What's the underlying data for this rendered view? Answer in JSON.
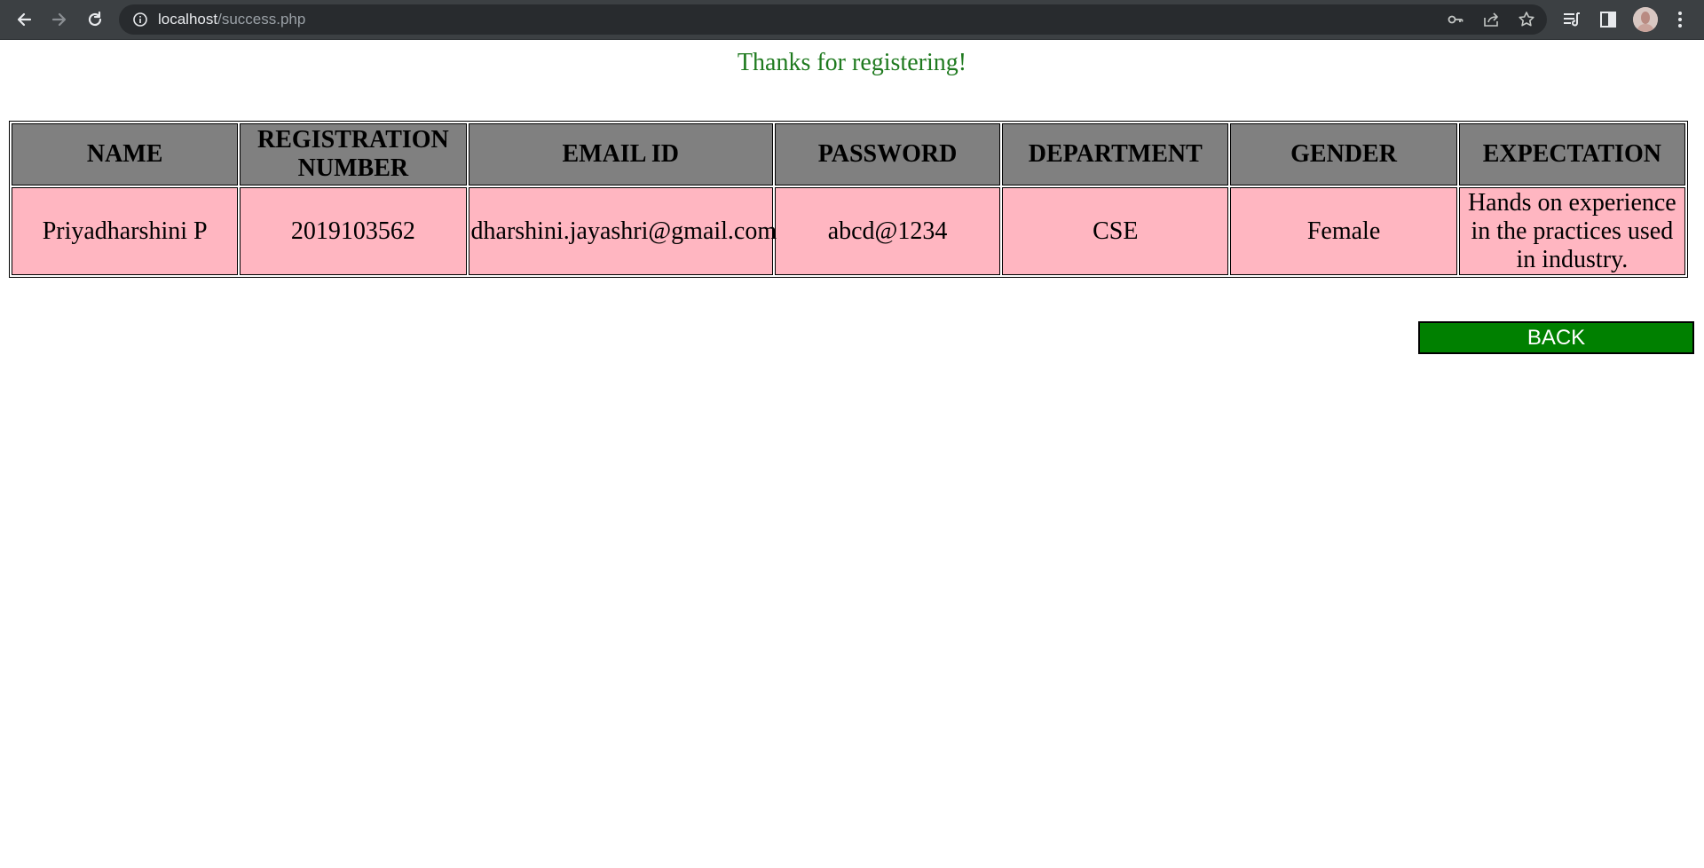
{
  "browser": {
    "url_host": "localhost",
    "url_path": "/success.php",
    "back_icon": "back-arrow-icon",
    "forward_icon": "forward-arrow-icon",
    "reload_icon": "reload-icon"
  },
  "page": {
    "message": "Thanks for registering!",
    "message_color": "#1f7a1f",
    "table": {
      "headers": [
        "NAME",
        "REGISTRATION NUMBER",
        "EMAIL ID",
        "PASSWORD",
        "DEPARTMENT",
        "GENDER",
        "EXPECTATION"
      ],
      "rows": [
        [
          "Priyadharshini P",
          "2019103562",
          "dharshini.jayashri@gmail.com",
          "abcd@1234",
          "CSE",
          "Female",
          "Hands on experience in the practices used in industry."
        ]
      ],
      "header_bg": "#808080",
      "row_bg": "#ffb6c1"
    },
    "back_button": {
      "label": "BACK",
      "bg": "#008000"
    }
  }
}
